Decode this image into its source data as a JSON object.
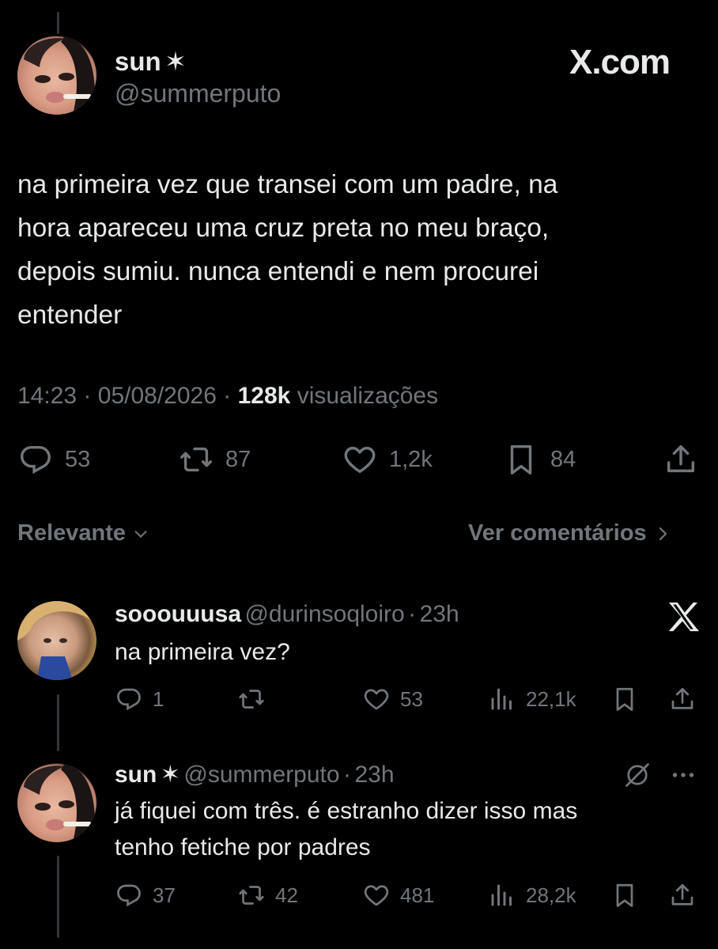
{
  "brand": {
    "site_label": "X.com"
  },
  "tweet": {
    "author_name": "sun",
    "author_star": "✶",
    "author_handle": "@summerputo",
    "text_lines": [
      "na primeira vez que transei com um padre, na",
      "hora apareceu uma cruz preta no meu braço,",
      "depois sumiu. nunca entendi e nem procurei",
      "entender"
    ],
    "time": "14:23",
    "date": "05/08/2026",
    "separator": "·",
    "views_count": "128k",
    "views_label": "visualizações",
    "actions": {
      "replies": "53",
      "reposts": "87",
      "likes": "1,2k",
      "bookmarks": "84"
    }
  },
  "sort_bar": {
    "sort_label": "Relevante",
    "comments_link": "Ver comentários"
  },
  "replies": [
    {
      "name": "sooouuusa",
      "handle": "@durinsoqloiro",
      "separator": "·",
      "age": "23h",
      "text_lines": [
        "na primeira vez?"
      ],
      "stats": {
        "replies": "1",
        "reposts": "",
        "likes": "53",
        "views": "22,1k"
      }
    },
    {
      "name": "sun",
      "star": "✶",
      "handle": "@summerputo",
      "separator": "·",
      "age": "23h",
      "text_lines": [
        "já fiquei com três. é estranho dizer isso mas",
        "tenho fetiche por padres"
      ],
      "stats": {
        "replies": "37",
        "reposts": "42",
        "likes": "481",
        "views": "28,2k"
      }
    }
  ],
  "colors": {
    "background": "#000000",
    "text": "#e7e9ea",
    "muted": "#71767b",
    "thread_line": "#333639"
  },
  "icons": [
    "reply-icon",
    "repost-icon",
    "like-icon",
    "bookmark-icon",
    "share-icon",
    "views-icon",
    "chevron-down-icon",
    "chevron-right-icon",
    "x-logo-icon",
    "muted-icon",
    "more-icon"
  ]
}
